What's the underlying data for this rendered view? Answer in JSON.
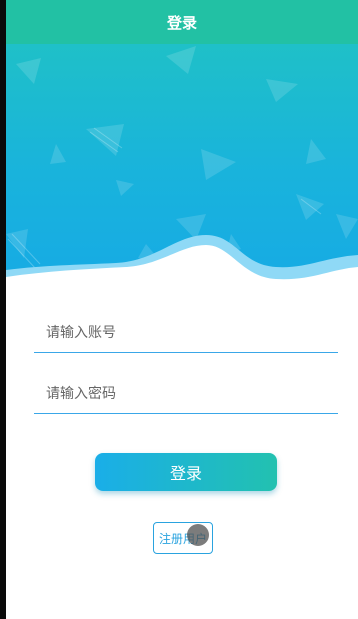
{
  "header": {
    "title": "登录"
  },
  "form": {
    "account_placeholder": "请输入账号",
    "password_placeholder": "请输入密码"
  },
  "actions": {
    "login_label": "登录",
    "register_label": "注册用户"
  },
  "colors": {
    "header": "#22c1a4",
    "accent": "#1aaee8",
    "accent2": "#22c1b0",
    "wave_light": "#8fd9f6"
  }
}
